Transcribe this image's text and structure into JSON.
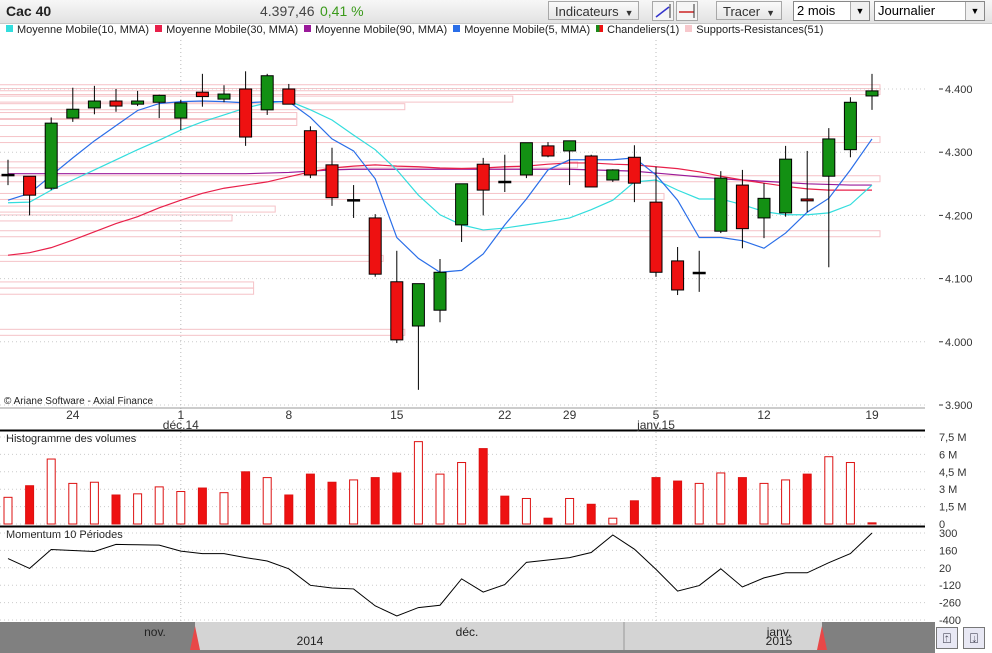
{
  "toolbar": {
    "title": "Cac 40",
    "price": "4.397,46",
    "change": "0,41 %",
    "indicators_label": "Indicateurs",
    "draw_label": "Tracer",
    "period_value": "2 mois",
    "interval_value": "Journalier",
    "trendline_icon": "trendline-icon",
    "hline_icon": "horizontal-line-icon"
  },
  "legend": [
    {
      "label": "Moyenne Mobile(10, MMA)",
      "color": "#33dddd"
    },
    {
      "label": "Moyenne Mobile(30, MMA)",
      "color": "#e8204a"
    },
    {
      "label": "Moyenne Mobile(90, MMA)",
      "color": "#9a1a9a"
    },
    {
      "label": "Moyenne Mobile(5, MMA)",
      "color": "#2a6ee8"
    },
    {
      "label": "Chandeliers(1)",
      "color": "#1a8a1a"
    },
    {
      "label": "Supports-Resistances(51)",
      "color": "#f7c8cc"
    }
  ],
  "copyright": "© Ariane Software - Axial Finance",
  "chart_data": {
    "type": "candlestick",
    "title": "Cac 40",
    "price_axis": {
      "ticks": [
        "4.400",
        "4.300",
        "4.200",
        "4.100",
        "4.000",
        "3.900"
      ],
      "values": [
        4400,
        4300,
        4200,
        4100,
        4000,
        3900
      ],
      "ylim": [
        3890,
        4450
      ]
    },
    "date_labels": [
      {
        "index": 3,
        "day": "24"
      },
      {
        "index": 8,
        "day": "1",
        "month": "déc.14"
      },
      {
        "index": 13,
        "day": "8"
      },
      {
        "index": 18,
        "day": "15"
      },
      {
        "index": 23,
        "day": "22"
      },
      {
        "index": 26,
        "day": "29"
      },
      {
        "index": 30,
        "day": "5",
        "month": "janv.15"
      },
      {
        "index": 35,
        "day": "12"
      },
      {
        "index": 40,
        "day": "19"
      }
    ],
    "candles": [
      [
        4263,
        4288,
        4248,
        4265
      ],
      [
        4262,
        4262,
        4200,
        4232
      ],
      [
        4243,
        4355,
        4240,
        4346
      ],
      [
        4354,
        4402,
        4348,
        4368
      ],
      [
        4370,
        4405,
        4360,
        4381
      ],
      [
        4381,
        4400,
        4364,
        4373
      ],
      [
        4376,
        4397,
        4373,
        4381
      ],
      [
        4379,
        4391,
        4354,
        4390
      ],
      [
        4354,
        4383,
        4335,
        4378
      ],
      [
        4395,
        4424,
        4372,
        4388
      ],
      [
        4384,
        4406,
        4379,
        4392
      ],
      [
        4400,
        4428,
        4310,
        4324
      ],
      [
        4367,
        4424,
        4359,
        4421
      ],
      [
        4400,
        4408,
        4376,
        4376
      ],
      [
        4334,
        4341,
        4259,
        4264
      ],
      [
        4280,
        4307,
        4215,
        4228
      ],
      [
        4225,
        4248,
        4196,
        4224
      ],
      [
        4196,
        4202,
        4103,
        4107
      ],
      [
        4095,
        4144,
        3998,
        4003
      ],
      [
        4025,
        4092,
        3924,
        4092
      ],
      [
        4050,
        4131,
        4031,
        4110
      ],
      [
        4185,
        4250,
        4158,
        4250
      ],
      [
        4281,
        4291,
        4200,
        4240
      ],
      [
        4254,
        4296,
        4237,
        4253
      ],
      [
        4264,
        4315,
        4259,
        4315
      ],
      [
        4310,
        4316,
        4292,
        4294
      ],
      [
        4302,
        4318,
        4248,
        4318
      ],
      [
        4294,
        4296,
        4245,
        4245
      ],
      [
        4256,
        4273,
        4253,
        4272
      ],
      [
        4292,
        4311,
        4221,
        4251
      ],
      [
        4221,
        4277,
        4103,
        4110
      ],
      [
        4128,
        4150,
        4074,
        4082
      ],
      [
        4110,
        4144,
        4079,
        4110
      ],
      [
        4175,
        4270,
        4172,
        4259
      ],
      [
        4248,
        4272,
        4148,
        4179
      ],
      [
        4196,
        4251,
        4164,
        4227
      ],
      [
        4204,
        4310,
        4198,
        4289
      ],
      [
        4226,
        4302,
        4205,
        4223
      ],
      [
        4262,
        4338,
        4118,
        4321
      ],
      [
        4304,
        4387,
        4292,
        4379
      ],
      [
        4389,
        4424,
        4367,
        4397
      ]
    ],
    "ma5": [
      4224,
      4235,
      4263,
      4291,
      4318,
      4342,
      4366,
      4377,
      4380,
      4381,
      4380,
      4378,
      4380,
      4380,
      4355,
      4321,
      4302,
      4258,
      4165,
      4132,
      4110,
      4113,
      4139,
      4185,
      4226,
      4272,
      4288,
      4288,
      4288,
      4291,
      4264,
      4224,
      4165,
      4165,
      4160,
      4148,
      4172,
      4205,
      4227,
      4272,
      4321
    ],
    "ma10": [
      4220,
      4221,
      4240,
      4256,
      4272,
      4288,
      4304,
      4319,
      4335,
      4348,
      4359,
      4370,
      4378,
      4381,
      4367,
      4351,
      4327,
      4304,
      4272,
      4232,
      4201,
      4185,
      4177,
      4180,
      4185,
      4190,
      4196,
      4209,
      4224,
      4253,
      4256,
      4240,
      4226,
      4226,
      4217,
      4206,
      4201,
      4201,
      4204,
      4217,
      4248
    ],
    "ma30": [
      4137,
      4141,
      4149,
      4161,
      4174,
      4187,
      4198,
      4212,
      4224,
      4235,
      4243,
      4248,
      4253,
      4261,
      4269,
      4275,
      4278,
      4280,
      4278,
      4277,
      4275,
      4274,
      4275,
      4277,
      4278,
      4281,
      4283,
      4283,
      4281,
      4280,
      4277,
      4274,
      4269,
      4262,
      4256,
      4251,
      4246,
      4242,
      4240,
      4240,
      4240
    ],
    "ma90": [
      4266,
      4266,
      4266,
      4266,
      4266,
      4266,
      4266,
      4266,
      4266,
      4266,
      4266,
      4266,
      4267,
      4268,
      4270,
      4272,
      4273,
      4273,
      4273,
      4273,
      4273,
      4273,
      4273,
      4273,
      4273,
      4273,
      4273,
      4272,
      4271,
      4270,
      4267,
      4264,
      4261,
      4258,
      4256,
      4254,
      4252,
      4250,
      4249,
      4248,
      4248
    ],
    "support_resistance": [
      {
        "price": 4402,
        "until_index": 40
      },
      {
        "price": 4396,
        "until_index": 40
      },
      {
        "price": 4384,
        "until_index": 23
      },
      {
        "price": 4372,
        "until_index": 18
      },
      {
        "price": 4358,
        "until_index": 13
      },
      {
        "price": 4347,
        "until_index": 13
      },
      {
        "price": 4320,
        "until_index": 40
      },
      {
        "price": 4280,
        "until_index": 26
      },
      {
        "price": 4258,
        "until_index": 40
      },
      {
        "price": 4230,
        "until_index": 30
      },
      {
        "price": 4210,
        "until_index": 12
      },
      {
        "price": 4196,
        "until_index": 10
      },
      {
        "price": 4171,
        "until_index": 40
      },
      {
        "price": 4132,
        "until_index": 17
      },
      {
        "price": 4090,
        "until_index": 11
      },
      {
        "price": 4080,
        "until_index": 11
      },
      {
        "price": 4015,
        "until_index": 18
      }
    ],
    "volume": {
      "title": "Histogramme des volumes",
      "ticks": [
        "7,5 M",
        "6 M",
        "4,5 M",
        "3 M",
        "1,5 M",
        "0"
      ],
      "tick_values": [
        7.5,
        6,
        4.5,
        3,
        1.5,
        0
      ],
      "unit": "M",
      "values": [
        2.3,
        3.3,
        5.6,
        3.5,
        3.6,
        2.5,
        2.6,
        3.2,
        2.8,
        3.1,
        2.7,
        4.5,
        4.0,
        2.5,
        4.3,
        3.6,
        3.8,
        4.0,
        4.4,
        7.1,
        4.3,
        5.3,
        6.5,
        2.4,
        2.2,
        0.5,
        2.2,
        1.7,
        0.5,
        2.0,
        4.0,
        3.7,
        3.5,
        4.4,
        4.0,
        3.5,
        3.8,
        4.3,
        5.8,
        5.3,
        0.1
      ],
      "filled": [
        0,
        1,
        0,
        0,
        0,
        1,
        0,
        0,
        0,
        1,
        0,
        1,
        0,
        1,
        1,
        1,
        0,
        1,
        1,
        0,
        0,
        0,
        1,
        1,
        0,
        1,
        0,
        1,
        0,
        1,
        1,
        1,
        0,
        0,
        1,
        0,
        0,
        1,
        0,
        0,
        1
      ]
    },
    "momentum": {
      "title": "Momentum 10 Périodes",
      "ticks": [
        "300",
        "160",
        "20",
        "-120",
        "-260",
        "-400"
      ],
      "tick_values": [
        300,
        160,
        20,
        -120,
        -260,
        -400
      ],
      "values": [
        94,
        15,
        167,
        159,
        151,
        208,
        205,
        202,
        154,
        134,
        134,
        102,
        75,
        12,
        -121,
        -142,
        -150,
        -286,
        -367,
        -300,
        -281,
        -69,
        -175,
        -115,
        64,
        83,
        102,
        143,
        284,
        170,
        7,
        -167,
        -123,
        12,
        -134,
        -61,
        -20,
        -20,
        61,
        134,
        300
      ]
    }
  },
  "navigator": {
    "labels": [
      {
        "text": "nov.",
        "row": 1
      },
      {
        "text": "2014",
        "row": 2
      },
      {
        "text": "déc.",
        "row": 1
      },
      {
        "text": "janv.",
        "row": 1
      },
      {
        "text": "2015",
        "row": 2
      }
    ],
    "zoom_in_icon": "zoom-in-panel-icon",
    "zoom_out_icon": "zoom-out-panel-icon"
  }
}
